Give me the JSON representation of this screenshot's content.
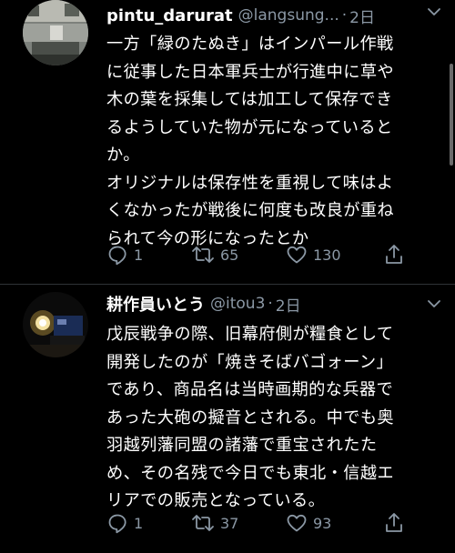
{
  "tweets": [
    {
      "display_name": "pintu_darurat",
      "handle": "@langsung...",
      "separator": "·",
      "time": "2日",
      "text": "一方「緑のたぬき」はインパール作戦\nに従事した日本軍兵士が行進中に草や\n木の葉を採集しては加工して保存でき\nるようしていた物が元になっていると\nか。\nオリジナルは保存性を重視して味はよ\nくなかったが戦後に何度も改良が重ね\nられて今の形になったとか",
      "replies": "1",
      "retweets": "65",
      "likes": "130"
    },
    {
      "display_name": "耕作員いとう",
      "handle": "@itou3",
      "separator": "·",
      "time": "2日",
      "text": "戊辰戦争の際、旧幕府側が糧食として\n開発したのが「焼きそばバゴォーン」\nであり、商品名は当時画期的な兵器で\nあった大砲の擬音とされる。中でも奥\n羽越列藩同盟の諸藩で重宝されたた\nめ、その名残で今日でも東北・信越エ\nリアでの販売となっている。",
      "replies": "1",
      "retweets": "37",
      "likes": "93"
    }
  ],
  "icons": {
    "reply": "reply-icon",
    "retweet": "retweet-icon",
    "like": "heart-icon",
    "share": "share-icon",
    "menu": "chevron-down-icon"
  },
  "colors": {
    "background": "#000000",
    "text": "#ffffff",
    "secondary": "#8b98a5",
    "divider": "#2f3336"
  }
}
